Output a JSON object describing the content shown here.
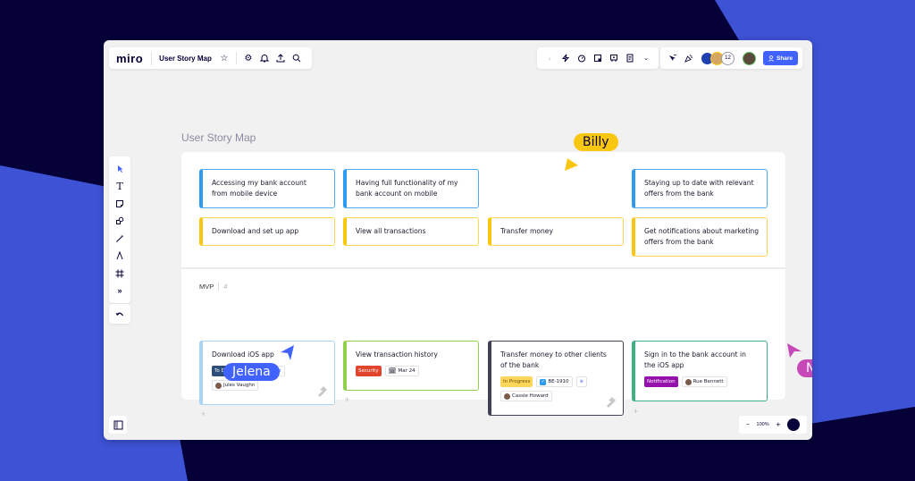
{
  "colors": {
    "background_dark": "#050038",
    "background_blue": "#3d52d5",
    "accent": "#4262ff",
    "card_blue": "#2d9bf0",
    "card_yellow": "#fac710"
  },
  "header": {
    "logo": "miro",
    "board_title": "User Story Map",
    "icons": [
      "star-icon",
      "settings-icon",
      "bell-icon",
      "upload-icon",
      "search-icon"
    ]
  },
  "toolbar_top": {
    "icons": [
      "chevron-right-icon",
      "lightning-icon",
      "timer-icon",
      "sticky-note-icon",
      "presentation-icon",
      "document-icon",
      "chevron-double-down-icon"
    ]
  },
  "collaboration": {
    "participant_count": "12",
    "share_label": "Share"
  },
  "left_toolbar": {
    "tools": [
      "select-icon",
      "text-icon",
      "sticky-note-icon",
      "shapes-icon",
      "pen-icon",
      "connection-icon",
      "frame-icon",
      "more-icon"
    ]
  },
  "board": {
    "label": "User Story Map",
    "activities": [
      "Accessing my bank account from mobile device",
      "Having full functionality of my bank account on mobile",
      "Staying up to date with relevant offers from the bank"
    ],
    "steps": [
      "Download and set up app",
      "View all transactions",
      "Transfer money",
      "Get notifications about marketing offers from the bank"
    ],
    "release": {
      "name": "MVP",
      "count": "4"
    },
    "tasks": [
      {
        "title": "Download iOS app",
        "status": "To Do",
        "status_color": "#2d4e7a",
        "issue": "BE-1820",
        "assignee": "Jules Vaughn",
        "border": "#a9d4f5"
      },
      {
        "title": "View transaction history",
        "status": "Security",
        "status_color": "#e0452b",
        "date": "Mar 24",
        "border": "#8fd14f"
      },
      {
        "title": "Transfer money to other clients of the bank",
        "status": "In Progress",
        "status_color": "#fdd65b",
        "issue": "BE-1910",
        "assignee": "Cassie Howard",
        "border": "#414156"
      },
      {
        "title": "Sign in to the bank account in the iOS app",
        "status": "Notification",
        "status_color": "#9510ac",
        "assignee": "Rue Bennett",
        "border": "#3fb081"
      }
    ]
  },
  "cursors": [
    {
      "name": "Billy",
      "color": "#fac710"
    },
    {
      "name": "Jelena",
      "color": "#4262ff"
    },
    {
      "name": "Nima",
      "color": "#c649b7"
    }
  ],
  "zoom": {
    "level": "100%",
    "minus": "−",
    "plus": "+",
    "help": "?"
  }
}
